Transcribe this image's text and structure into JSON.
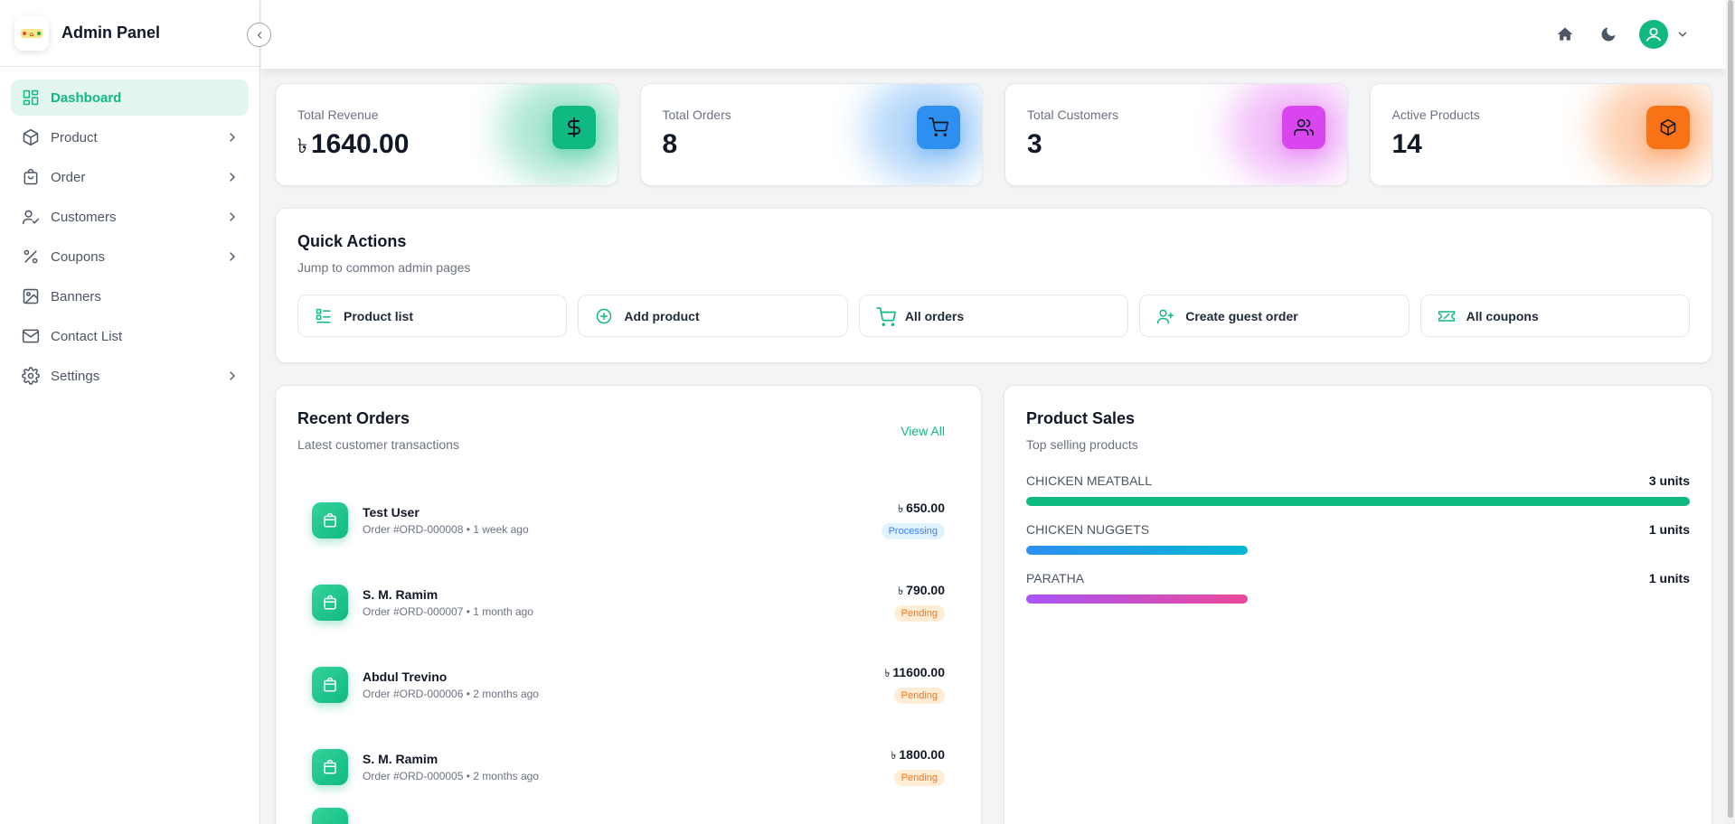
{
  "sidebar": {
    "title": "Admin Panel",
    "items": [
      {
        "label": "Dashboard",
        "icon": "dashboard-icon",
        "active": true,
        "has_children": false
      },
      {
        "label": "Product",
        "icon": "box-icon",
        "active": false,
        "has_children": true
      },
      {
        "label": "Order",
        "icon": "shopping-bag-icon",
        "active": false,
        "has_children": true
      },
      {
        "label": "Customers",
        "icon": "user-check-icon",
        "active": false,
        "has_children": true
      },
      {
        "label": "Coupons",
        "icon": "percent-icon",
        "active": false,
        "has_children": true
      },
      {
        "label": "Banners",
        "icon": "image-icon",
        "active": false,
        "has_children": false
      },
      {
        "label": "Contact List",
        "icon": "mail-icon",
        "active": false,
        "has_children": false
      },
      {
        "label": "Settings",
        "icon": "gear-icon",
        "active": false,
        "has_children": true
      }
    ]
  },
  "stats": [
    {
      "label": "Total Revenue",
      "currency": "৳",
      "value": "1640.00",
      "icon": "dollar-icon",
      "color": "#10b981"
    },
    {
      "label": "Total Orders",
      "currency": "",
      "value": "8",
      "icon": "cart-icon",
      "color": "#2d8ff0"
    },
    {
      "label": "Total Customers",
      "currency": "",
      "value": "3",
      "icon": "users-icon",
      "color": "#d946ef"
    },
    {
      "label": "Active Products",
      "currency": "",
      "value": "14",
      "icon": "box-icon",
      "color": "#f97316"
    }
  ],
  "quick_actions": {
    "title": "Quick Actions",
    "subtitle": "Jump to common admin pages",
    "buttons": [
      {
        "label": "Product list",
        "icon": "list-icon"
      },
      {
        "label": "Add product",
        "icon": "plus-circle-icon"
      },
      {
        "label": "All orders",
        "icon": "cart-icon"
      },
      {
        "label": "Create guest order",
        "icon": "user-plus-icon"
      },
      {
        "label": "All coupons",
        "icon": "ticket-icon"
      }
    ]
  },
  "recent_orders": {
    "title": "Recent Orders",
    "subtitle": "Latest customer transactions",
    "view_all": "View All",
    "orders": [
      {
        "name": "Test User",
        "meta": "Order #ORD-000008 • 1 week ago",
        "currency": "৳",
        "amount": "650.00",
        "status": "Processing"
      },
      {
        "name": "S. M. Ramim",
        "meta": "Order #ORD-000007 • 1 month ago",
        "currency": "৳",
        "amount": "790.00",
        "status": "Pending"
      },
      {
        "name": "Abdul Trevino",
        "meta": "Order #ORD-000006 • 2 months ago",
        "currency": "৳",
        "amount": "11600.00",
        "status": "Pending"
      },
      {
        "name": "S. M. Ramim",
        "meta": "Order #ORD-000005 • 2 months ago",
        "currency": "৳",
        "amount": "1800.00",
        "status": "Pending"
      }
    ]
  },
  "product_sales": {
    "title": "Product Sales",
    "subtitle": "Top selling products",
    "items": [
      {
        "name": "CHICKEN MEATBALL",
        "units_label": "3 units",
        "units": 3,
        "color_from": "#10b981",
        "color_to": "#10b981"
      },
      {
        "name": "CHICKEN NUGGETS",
        "units_label": "1 units",
        "units": 1,
        "color_from": "#2d8ff0",
        "color_to": "#06b6d4"
      },
      {
        "name": "PARATHA",
        "units_label": "1 units",
        "units": 1,
        "color_from": "#a855f7",
        "color_to": "#ec4899"
      }
    ]
  }
}
